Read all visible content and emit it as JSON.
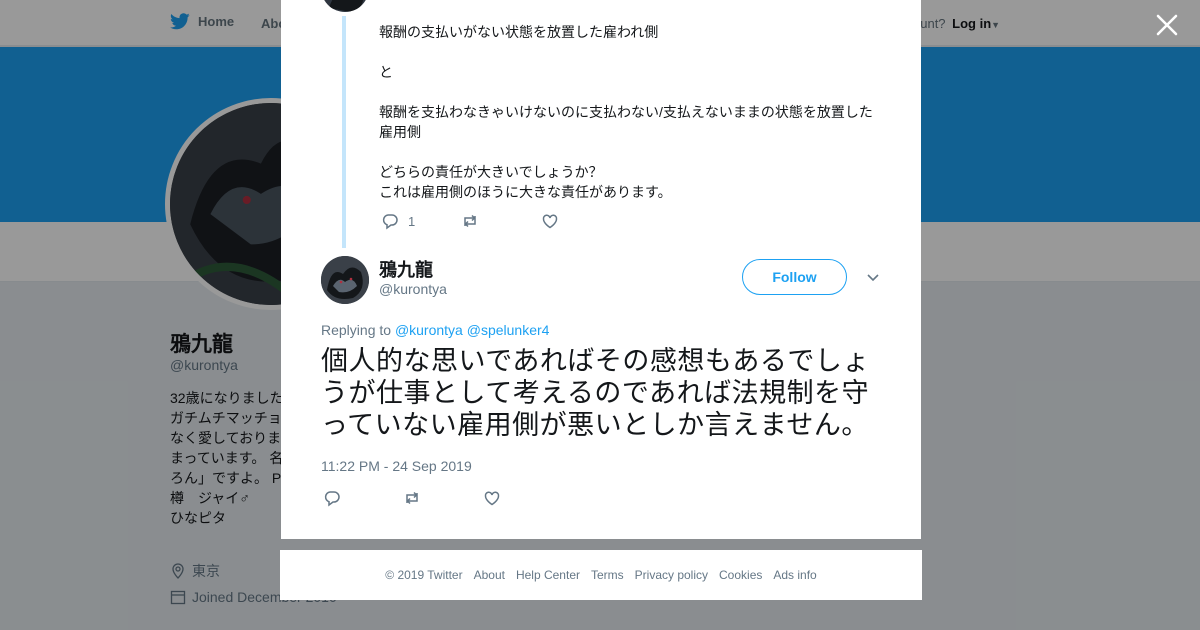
{
  "nav": {
    "home": "Home",
    "about": "Abo",
    "account_prompt": "ccount?",
    "login": "Log in"
  },
  "profile": {
    "name": "鴉九龍",
    "handle": "@kurontya",
    "bio": "32歳になりました\nガチムチマッチョ\nなく愛しておりま\nまっています。 名\nろん」ですよ。 P\n樽　ジャイ♂\nひなピタ",
    "location": "東京",
    "joined": "Joined December 2010"
  },
  "thread": {
    "previous_text": "報酬の支払いがない状態を放置した雇われ側\n\nと\n\n報酬を支払わなきゃいけないのに支払わない/支払えないままの状態を放置した雇用側\n\nどちらの責任が大きいでしょうか？\nこれは雇用側のほうに大きな責任があります。",
    "previous_reply_count": "1"
  },
  "tweet": {
    "author_name": "鴉九龍",
    "author_handle": "@kurontya",
    "follow_label": "Follow",
    "replying_prefix": "Replying to",
    "replying_to_1": "@kurontya",
    "replying_to_2": "@spelunker4",
    "text": "個人的な思いであればその感想もあるでしょうが仕事として考えるのであれば法規制を守っていない雇用側が悪いとしか言えません。",
    "timestamp": "11:22 PM - 24 Sep 2019"
  },
  "footer": {
    "copyright": "© 2019 Twitter",
    "links": [
      "About",
      "Help Center",
      "Terms",
      "Privacy policy",
      "Cookies",
      "Ads info"
    ]
  },
  "colors": {
    "brand": "#1da1f2",
    "muted": "#657786",
    "thread_line": "#c4e5fb"
  },
  "icons": {
    "close": "close-icon",
    "reply": "reply-icon",
    "retweet": "retweet-icon",
    "like": "heart-icon"
  }
}
